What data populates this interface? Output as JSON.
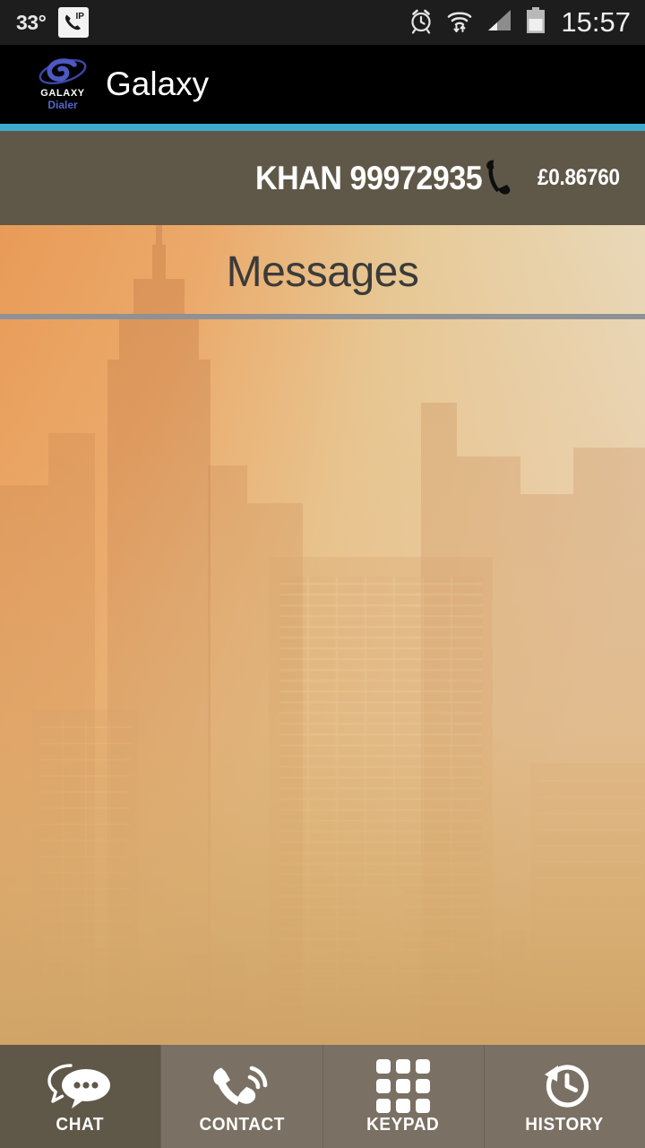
{
  "statusbar": {
    "temperature": "33°",
    "voip_icon": "voip-phone-icon",
    "alarm_icon": "alarm-clock-icon",
    "wifi_icon": "wifi-transfer-icon",
    "signal_icon": "cellular-signal-icon",
    "battery_icon": "battery-icon",
    "time": "15:57"
  },
  "header": {
    "logo_galaxy": "GALAXY",
    "logo_dialer": "Dialer",
    "title": "Galaxy",
    "accent_color": "#3fa9ce"
  },
  "account": {
    "name": "KHAN 99972935",
    "phone_icon": "telephone-handset-icon",
    "balance": "£0.86760",
    "background_color": "#5f5748"
  },
  "main": {
    "page_title": "Messages",
    "title_color": "#3b3b3b",
    "divider_color": "#8e9196",
    "background": "hazy-orange-city-skyline"
  },
  "tabbar": {
    "active_index": 0,
    "active_color": "#5f5748",
    "inactive_color": "#7a7063",
    "tabs": [
      {
        "label": "CHAT",
        "icon": "chat-bubbles-icon"
      },
      {
        "label": "CONTACT",
        "icon": "phone-call-icon"
      },
      {
        "label": "KEYPAD",
        "icon": "keypad-grid-icon"
      },
      {
        "label": "HISTORY",
        "icon": "clock-history-icon"
      }
    ]
  }
}
